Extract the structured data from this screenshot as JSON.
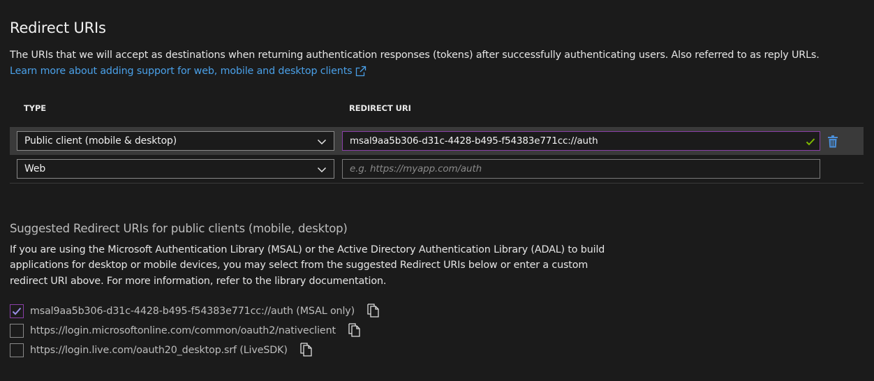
{
  "section": {
    "title": "Redirect URIs",
    "description": "The URIs that we will accept as destinations when returning authentication responses (tokens) after successfully authenticating users. Also referred to as reply URLs.",
    "learn_more": "Learn more about adding support for web, mobile and desktop clients"
  },
  "table": {
    "col_type": "TYPE",
    "col_uri": "REDIRECT URI",
    "rows": [
      {
        "type": "Public client (mobile & desktop)",
        "uri": "msal9aa5b306-d31c-4428-b495-f54383e771cc://auth",
        "placeholder": ""
      },
      {
        "type": "Web",
        "uri": "",
        "placeholder": "e.g. https://myapp.com/auth"
      }
    ]
  },
  "suggested": {
    "title": "Suggested Redirect URIs for public clients (mobile, desktop)",
    "description": "If you are using the Microsoft Authentication Library (MSAL) or the Active Directory Authentication Library (ADAL) to build applications for desktop or mobile devices, you may select from the suggested Redirect URIs below or enter a custom redirect URI above. For more information, refer to the library documentation.",
    "items": [
      {
        "label": "msal9aa5b306-d31c-4428-b495-f54383e771cc://auth (MSAL only)",
        "checked": true
      },
      {
        "label": "https://login.microsoftonline.com/common/oauth2/nativeclient",
        "checked": false
      },
      {
        "label": "https://login.live.com/oauth20_desktop.srf (LiveSDK)",
        "checked": false
      }
    ]
  },
  "colors": {
    "background": "#1b1b1b",
    "link": "#4aa0e8",
    "selected_row": "#3a3a3a",
    "focus_border": "#8a3fa8",
    "valid_check": "#7fba00",
    "delete_icon": "#4a8fd9"
  },
  "icons": [
    "external-link-icon",
    "chevron-down-icon",
    "checkmark-icon",
    "trash-icon",
    "copy-icon"
  ]
}
